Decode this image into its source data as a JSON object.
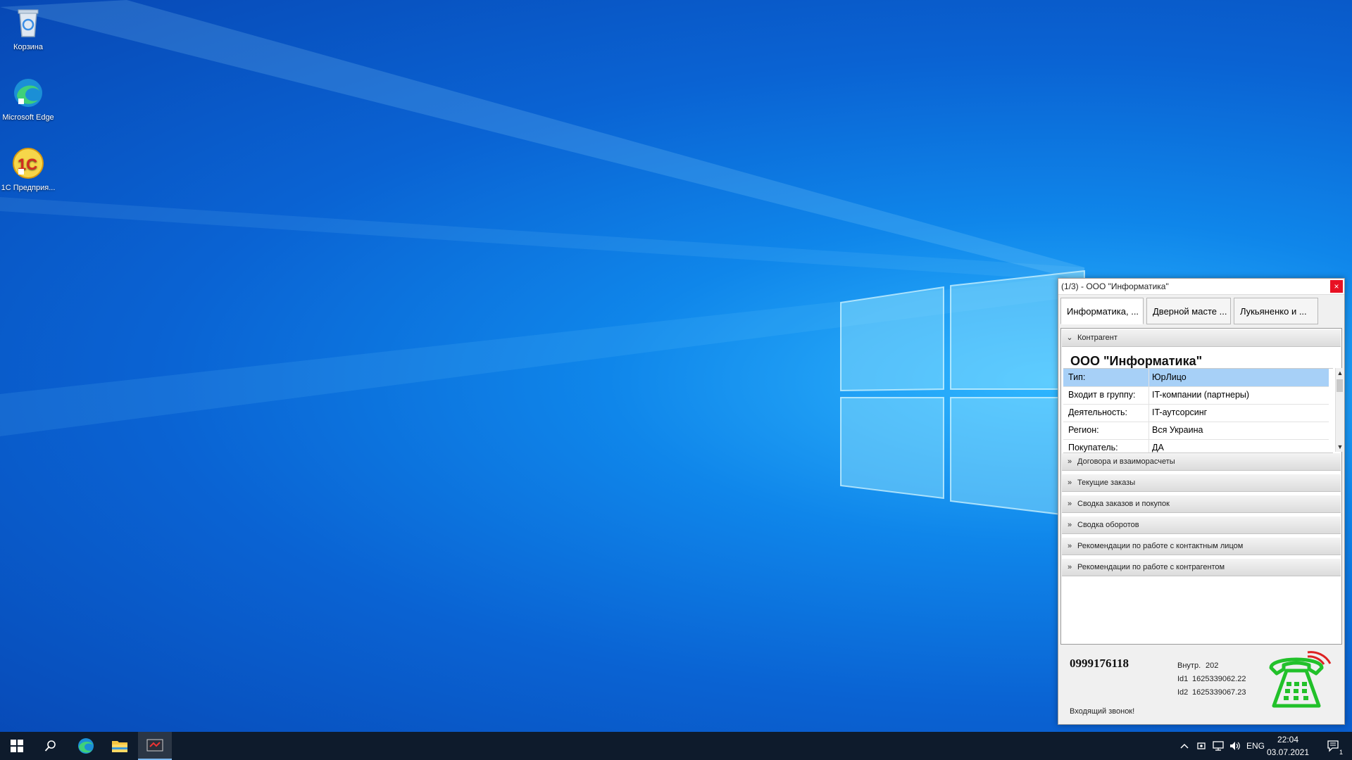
{
  "desktop": {
    "icons": [
      {
        "label": "Корзина",
        "icon": "recycle-bin-icon"
      },
      {
        "label": "Microsoft Edge",
        "icon": "edge-icon"
      },
      {
        "label": "1С Предприя...",
        "icon": "1c-icon"
      }
    ]
  },
  "popup": {
    "title": "(1/3) - ООО \"Информатика\"",
    "close_label": "×",
    "tabs": [
      {
        "label": "Информатика, ..."
      },
      {
        "label": "Дверной масте ..."
      },
      {
        "label": "Лукьяненко и ..."
      }
    ],
    "sections": {
      "contractor": "Контрагент",
      "contracts": "Договора и взаиморасчеты",
      "orders": "Текущие заказы",
      "summary_orders": "Сводка заказов и покупок",
      "summary_turnover": "Сводка оборотов",
      "rec_contact": "Рекомендации по работе с контактным лицом",
      "rec_contractor": "Рекомендации по работе с контрагентом"
    },
    "company_name": "ООО \"Информатика\"",
    "properties": [
      {
        "key": "Тип:",
        "value": "ЮрЛицо"
      },
      {
        "key": "Входит в группу:",
        "value": "IT-компании (партнеры)"
      },
      {
        "key": "Деятельность:",
        "value": "IT-аутсорсинг"
      },
      {
        "key": "Регион:",
        "value": "Вся Украина"
      },
      {
        "key": "Покупатель:",
        "value": "ДА"
      }
    ],
    "phone_number": "0999176118",
    "internal_label": "Внутр.",
    "internal_value": "202",
    "id1_label": "Id1",
    "id1_value": "1625339062.22",
    "id2_label": "Id2",
    "id2_value": "1625339067.23",
    "status": "Входящий звонок!",
    "phone_icon": "telephone-icon",
    "accent_color": "#22c12a"
  },
  "taskbar": {
    "language": "ENG",
    "time": "22:04",
    "date": "03.07.2021",
    "notification_count": "1"
  }
}
